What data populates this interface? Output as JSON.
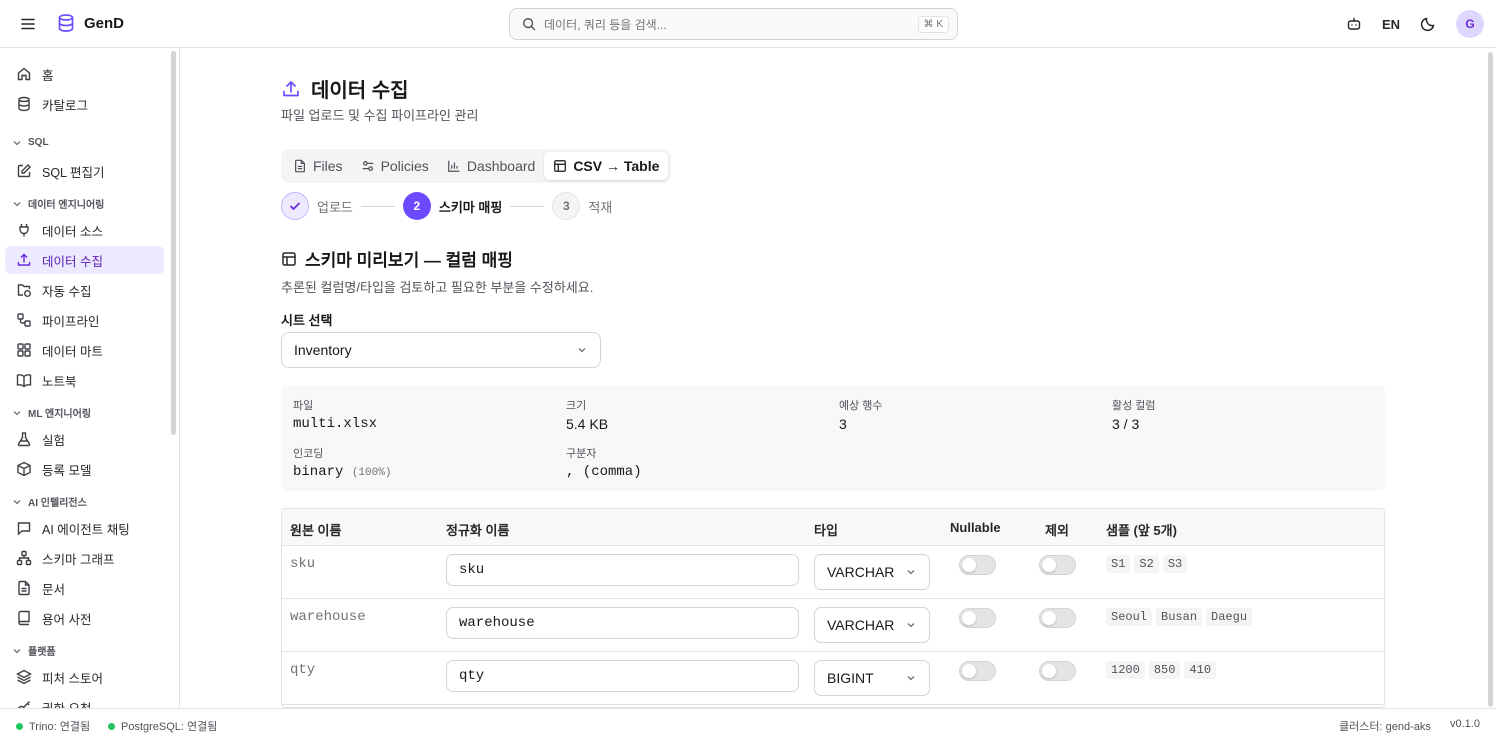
{
  "header": {
    "brand": "GenD",
    "search_placeholder": "데이터, 쿼리 등을 검색...",
    "search_shortcut": "⌘ K",
    "lang": "EN",
    "avatar_initial": "G"
  },
  "sidebar": {
    "home": "홈",
    "catalog": "카탈로그",
    "sec_sql": "SQL",
    "sql_editor": "SQL 편집기",
    "sec_data_eng": "데이터 엔지니어링",
    "data_source": "데이터 소스",
    "data_ingest": "데이터 수집",
    "auto_ingest": "자동 수집",
    "pipeline": "파이프라인",
    "data_mart": "데이터 마트",
    "notebook": "노트북",
    "sec_ml": "ML 엔지니어링",
    "experiment": "실험",
    "registered_model": "등록 모델",
    "sec_ai": "AI 인텔리전스",
    "ai_agent_chat": "AI 에이전트 채팅",
    "schema_graph": "스키마 그래프",
    "documents": "문서",
    "glossary": "용어 사전",
    "sec_platform": "플랫폼",
    "feature_store": "피처 스토어",
    "permission_request": "권한 요청"
  },
  "page": {
    "title": "데이터 수집",
    "subtitle": "파일 업로드 및 수집 파이프라인 관리"
  },
  "tabs": {
    "files": "Files",
    "policies": "Policies",
    "dashboard": "Dashboard",
    "csv_table": "CSV → Table"
  },
  "stepper": {
    "step1_label": "업로드",
    "step2_num": "2",
    "step2_label": "스키마 매핑",
    "step3_num": "3",
    "step3_label": "적재"
  },
  "schema": {
    "title": "스키마 미리보기 — 컬럼 매핑",
    "subtitle": "추론된 컬럼명/타입을 검토하고 필요한 부분을 수정하세요.",
    "sheet_label": "시트 선택",
    "sheet_value": "Inventory"
  },
  "file_info": {
    "file_label": "파일",
    "file_value": "multi.xlsx",
    "size_label": "크기",
    "size_value": "5.4 KB",
    "rows_label": "예상 행수",
    "rows_value": "3",
    "active_cols_label": "활성 컬럼",
    "active_cols_value": "3 / 3",
    "encoding_label": "인코딩",
    "encoding_value": "binary",
    "encoding_confidence": "(100%)",
    "delimiter_label": "구분자",
    "delimiter_value": ", (comma)"
  },
  "table": {
    "headers": {
      "original": "원본 이름",
      "normalized": "정규화 이름",
      "type": "타입",
      "nullable": "Nullable",
      "exclude": "제외",
      "samples": "샘플 (앞 5개)"
    },
    "rows": [
      {
        "original": "sku",
        "normalized": "sku",
        "type": "VARCHAR",
        "nullable": false,
        "exclude": false,
        "samples": [
          "S1",
          "S2",
          "S3"
        ]
      },
      {
        "original": "warehouse",
        "normalized": "warehouse",
        "type": "VARCHAR",
        "nullable": false,
        "exclude": false,
        "samples": [
          "Seoul",
          "Busan",
          "Daegu"
        ]
      },
      {
        "original": "qty",
        "normalized": "qty",
        "type": "BIGINT",
        "nullable": false,
        "exclude": false,
        "samples": [
          "1200",
          "850",
          "410"
        ]
      }
    ]
  },
  "footer": {
    "trino": "Trino: 연결됨",
    "postgres": "PostgreSQL: 연결됨",
    "cluster": "클러스터: gend-aks",
    "version": "v0.1.0"
  },
  "colors": {
    "accent": "#6d4aff",
    "active_bg": "#ede9fe",
    "status_ok": "#22c55e"
  }
}
